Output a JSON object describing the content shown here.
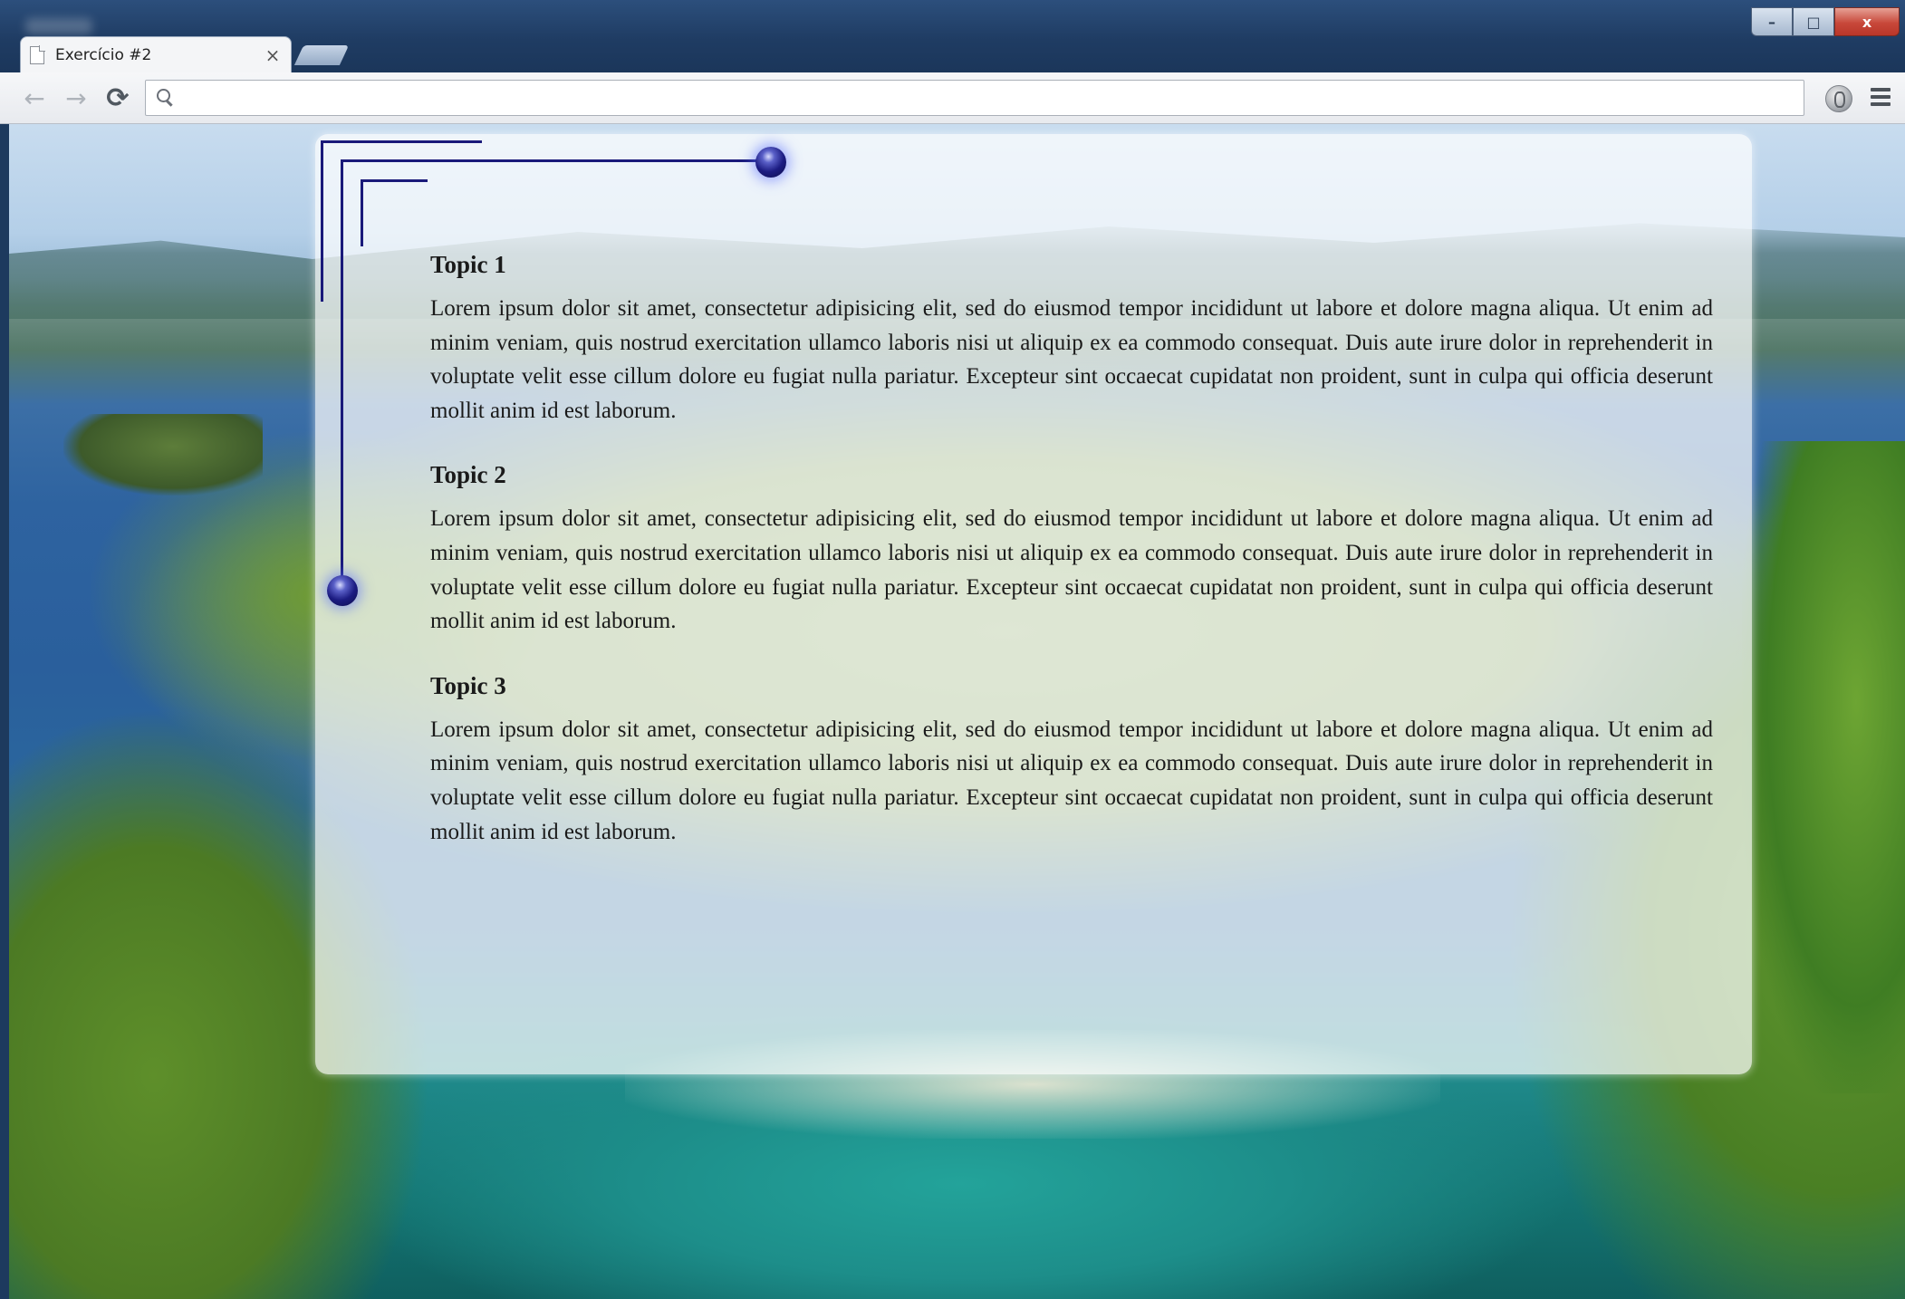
{
  "browser": {
    "tab": {
      "title": "Exercício #2",
      "close_glyph": "×"
    },
    "window_controls": {
      "minimize": "–",
      "maximize": "□",
      "close": "x"
    },
    "nav": {
      "back_glyph": "←",
      "forward_glyph": "→",
      "reload_glyph": "⟳"
    },
    "omnibox": {
      "value": "",
      "placeholder": ""
    },
    "icons": {
      "page": "page-icon",
      "search": "search-icon",
      "extension": "extension-icon",
      "menu": "menu-icon"
    }
  },
  "page": {
    "accent_color": "#1a1a7a",
    "topics": [
      {
        "heading": "Topic 1",
        "body": "Lorem ipsum dolor sit amet, consectetur adipisicing elit, sed do eiusmod tempor incididunt ut labore et dolore magna aliqua. Ut enim ad minim veniam, quis nostrud exercitation ullamco laboris nisi ut aliquip ex ea commodo consequat. Duis aute irure dolor in reprehenderit in voluptate velit esse cillum dolore eu fugiat nulla pariatur. Excepteur sint occaecat cupidatat non proident, sunt in culpa qui officia deserunt mollit anim id est laborum."
      },
      {
        "heading": "Topic 2",
        "body": "Lorem ipsum dolor sit amet, consectetur adipisicing elit, sed do eiusmod tempor incididunt ut labore et dolore magna aliqua. Ut enim ad minim veniam, quis nostrud exercitation ullamco laboris nisi ut aliquip ex ea commodo consequat. Duis aute irure dolor in reprehenderit in voluptate velit esse cillum dolore eu fugiat nulla pariatur. Excepteur sint occaecat cupidatat non proident, sunt in culpa qui officia deserunt mollit anim id est laborum."
      },
      {
        "heading": "Topic 3",
        "body": "Lorem ipsum dolor sit amet, consectetur adipisicing elit, sed do eiusmod tempor incididunt ut labore et dolore magna aliqua. Ut enim ad minim veniam, quis nostrud exercitation ullamco laboris nisi ut aliquip ex ea commodo consequat. Duis aute irure dolor in reprehenderit in voluptate velit esse cillum dolore eu fugiat nulla pariatur. Excepteur sint occaecat cupidatat non proident, sunt in culpa qui officia deserunt mollit anim id est laborum."
      }
    ]
  }
}
